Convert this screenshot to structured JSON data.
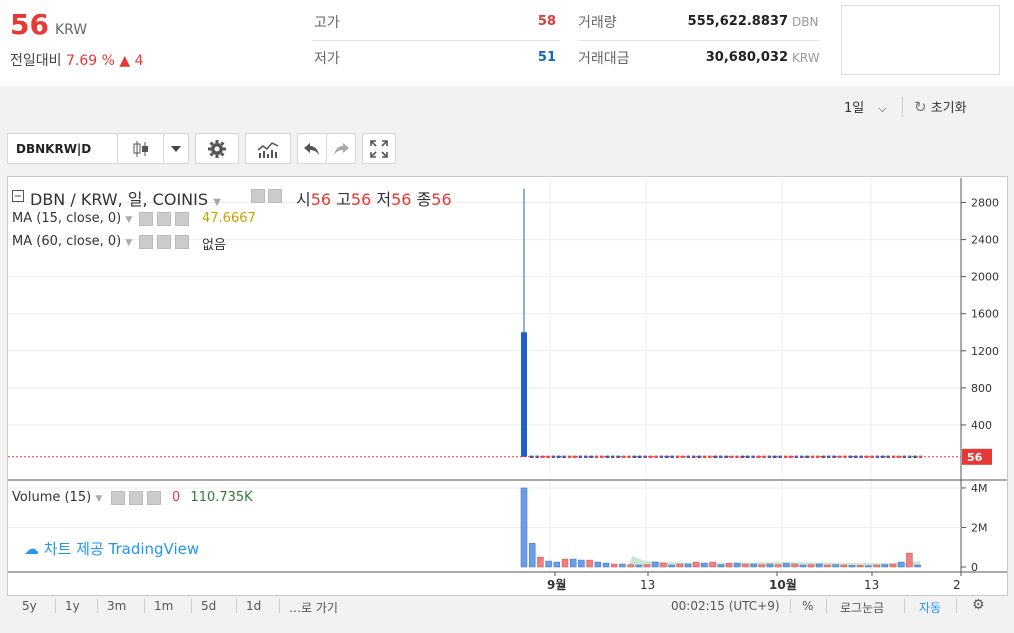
{
  "header": {
    "price": "56",
    "unit": "KRW",
    "change_label": "전일대비",
    "change_pct": "7.69 %",
    "change_arrow": "▲",
    "change_amt": "4",
    "high_label": "고가",
    "high_value": "58",
    "low_label": "저가",
    "low_value": "51",
    "volume_label": "거래량",
    "volume_value": "555,622.8837",
    "volume_unit": "DBN",
    "amount_label": "거래대금",
    "amount_value": "30,680,032",
    "amount_unit": "KRW"
  },
  "toolbar": {
    "interval": "1일",
    "reset": "초기화",
    "symbol": "DBNKRW|D"
  },
  "legend": {
    "title": "DBN / KRW, 일, COINIS",
    "o_label": "시",
    "o_value": "56",
    "h_label": "고",
    "h_value": "56",
    "l_label": "저",
    "l_value": "56",
    "c_label": "종",
    "c_value": "56",
    "ma15_label": "MA (15, close, 0)",
    "ma15_value": "47.6667",
    "ma60_label": "MA (60, close, 0)",
    "ma60_value": "없음",
    "volume_label": "Volume (15)",
    "volume_value1": "0",
    "volume_value2": "110.735K",
    "provider": "차트 제공 TradingView"
  },
  "chart_data": {
    "type": "candlestick",
    "price_axis": [
      "2800",
      "2400",
      "2000",
      "1600",
      "1200",
      "800",
      "400"
    ],
    "price_ylim": [
      0,
      3000
    ],
    "last_price_label": "56",
    "volume_axis": [
      "4M",
      "2M",
      "0"
    ],
    "volume_ylim": [
      0,
      4200000
    ],
    "time_axis": [
      "9월",
      "13",
      "10월",
      "13",
      "2"
    ],
    "volume_bars": [
      4000000,
      1200000,
      500000,
      300000,
      250000,
      400000,
      400000,
      350000,
      350000,
      250000,
      200000,
      150000,
      150000,
      120000,
      100000,
      120000,
      250000,
      200000,
      100000,
      150000,
      150000,
      250000,
      200000,
      250000,
      120000,
      180000,
      200000,
      150000,
      150000,
      120000,
      150000,
      120000,
      180000,
      150000,
      100000,
      120000,
      150000,
      100000,
      120000,
      100000,
      80000,
      80000,
      60000,
      100000,
      120000,
      150000,
      250000,
      700000,
      100000
    ]
  },
  "bottom": {
    "ranges": [
      "5y",
      "1y",
      "3m",
      "1m",
      "5d",
      "1d",
      "…로 가기"
    ],
    "time": "00:02:15 (UTC+9)",
    "percent": "%",
    "log": "로그눈금",
    "auto": "자동"
  }
}
